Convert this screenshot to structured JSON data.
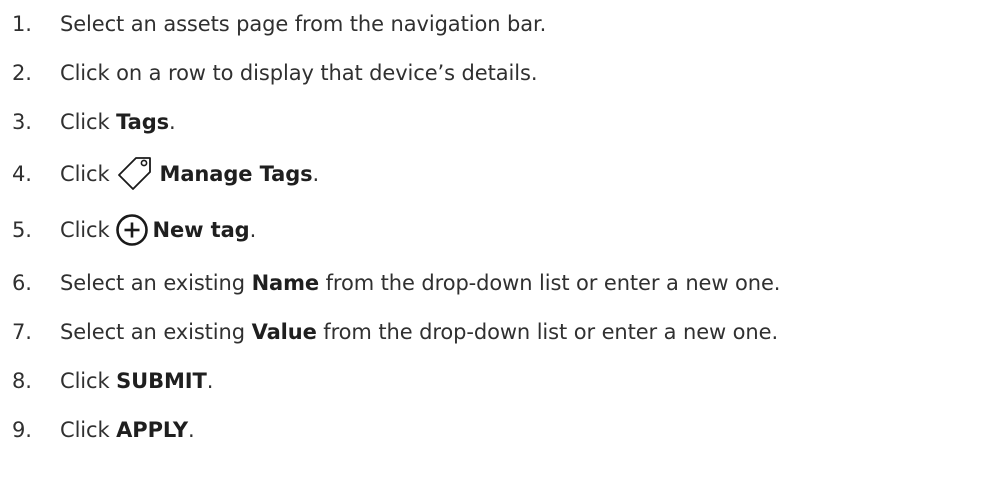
{
  "steps": [
    {
      "number": "1.",
      "text": "Select an assets page from the navigation bar."
    },
    {
      "number": "2.",
      "text": "Click on a row to display that device’s details."
    },
    {
      "number": "3.",
      "prefix": "Click ",
      "bold": "Tags",
      "suffix": "."
    },
    {
      "number": "4.",
      "prefix": "Click",
      "icon": "tag-icon",
      "bold": "Manage Tags",
      "suffix": "."
    },
    {
      "number": "5.",
      "prefix": "Click",
      "icon": "plus-circle-icon",
      "bold": "New tag",
      "suffix": "."
    },
    {
      "number": "6.",
      "prefix": "Select an existing ",
      "bold": "Name",
      "suffix": " from the drop-down list or enter a new one."
    },
    {
      "number": "7.",
      "prefix": "Select an existing ",
      "bold": "Value",
      "suffix": " from the drop-down list or enter a new one."
    },
    {
      "number": "8.",
      "prefix": "Click ",
      "bold": "SUBMIT",
      "suffix": "."
    },
    {
      "number": "9.",
      "prefix": "Click ",
      "bold": "APPLY",
      "suffix": "."
    }
  ],
  "colors": {
    "text": "#303030",
    "bold_text": "#1f1f1f",
    "icon_stroke": "#1a1a1a"
  }
}
